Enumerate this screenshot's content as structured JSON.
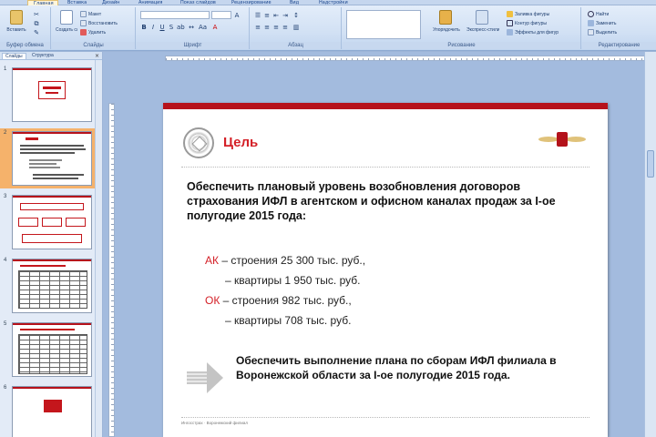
{
  "ribbon": {
    "tabs": [
      "Главная",
      "Вставка",
      "Дизайн",
      "Анимация",
      "Показ слайдов",
      "Рецензирование",
      "Вид",
      "Надстройки"
    ],
    "active_tab": 0,
    "groups": {
      "clipboard": {
        "label": "Буфер обмена",
        "paste": "Вставить"
      },
      "slides": {
        "label": "Слайды",
        "new_slide": "Создать слайд",
        "layout": "Макет",
        "reset": "Восстановить",
        "delete": "Удалить"
      },
      "font": {
        "label": "Шрифт"
      },
      "paragraph": {
        "label": "Абзац"
      },
      "drawing": {
        "label": "Рисование",
        "arrange": "Упорядочить",
        "quick_styles": "Экспресс-стили",
        "fill": "Заливка фигуры",
        "outline": "Контур фигуры",
        "effects": "Эффекты для фигур"
      },
      "editing": {
        "label": "Редактирование",
        "find": "Найти",
        "replace": "Заменить",
        "select": "Выделить"
      }
    }
  },
  "panel": {
    "tabs": [
      "Слайды",
      "Структура"
    ],
    "close": "×",
    "slides": [
      {
        "num": "1"
      },
      {
        "num": "2",
        "selected": true
      },
      {
        "num": "3"
      },
      {
        "num": "4"
      },
      {
        "num": "5"
      },
      {
        "num": "6"
      }
    ]
  },
  "slide": {
    "title": "Цель",
    "paragraph1": "Обеспечить плановый уровень возобновления договоров страхования ИФЛ в агентском и офисном каналах продаж за I-ое полугодие 2015 года:",
    "lines": [
      {
        "label": "АК",
        "text": " – строения 25 300 тыс. руб.,"
      },
      {
        "label": "",
        "text": "– квартиры  1 950 тыс. руб."
      },
      {
        "label": "ОК",
        "text": " – строения  982 тыс. руб.,"
      },
      {
        "label": "",
        "text": "– квартиры  708 тыс. руб."
      }
    ],
    "paragraph2": "Обеспечить выполнение плана по сборам ИФЛ филиала в Воронежской области за I-ое полугодие 2015 года.",
    "footer": "Ингосстрах · Воронежский филиал",
    "accent_color": "#d42027",
    "bar_color": "#b6121b"
  }
}
